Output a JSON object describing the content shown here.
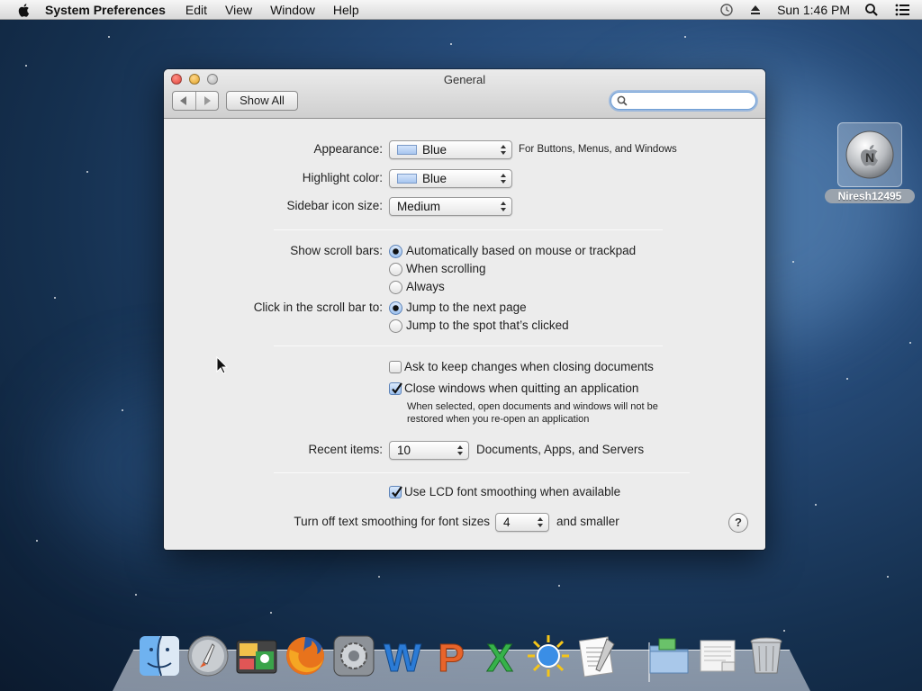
{
  "menubar": {
    "app_name": "System Preferences",
    "menus": [
      "Edit",
      "View",
      "Window",
      "Help"
    ],
    "clock": "Sun 1:46 PM"
  },
  "window": {
    "title": "General",
    "show_all_label": "Show All",
    "search_placeholder": ""
  },
  "general": {
    "appearance": {
      "label": "Appearance:",
      "value": "Blue",
      "hint": "For Buttons, Menus, and Windows"
    },
    "highlight": {
      "label": "Highlight color:",
      "value": "Blue"
    },
    "sidebar_icon_size": {
      "label": "Sidebar icon size:",
      "value": "Medium"
    },
    "scroll_bars": {
      "label": "Show scroll bars:",
      "options": [
        "Automatically based on mouse or trackpad",
        "When scrolling",
        "Always"
      ],
      "selected_index": 0
    },
    "click_scroll_bar": {
      "label": "Click in the scroll bar to:",
      "options": [
        "Jump to the next page",
        "Jump to the spot that’s clicked"
      ],
      "selected_index": 0
    },
    "ask_keep_changes": {
      "label": "Ask to keep changes when closing documents",
      "checked": false
    },
    "close_windows": {
      "label": "Close windows when quitting an application",
      "checked": true,
      "note_line1": "When selected, open documents and windows will not be",
      "note_line2": "restored when you re-open an application"
    },
    "recent_items": {
      "label": "Recent items:",
      "value": "10",
      "suffix": "Documents, Apps, and Servers"
    },
    "lcd_smoothing": {
      "label": "Use LCD font smoothing when available",
      "checked": true
    },
    "text_smoothing": {
      "label": "Turn off text smoothing for font sizes",
      "value": "4",
      "suffix": "and smaller"
    },
    "help_label": "?"
  },
  "desktop": {
    "user_name": "Niresh12495",
    "user_initial": "N"
  },
  "dock": {
    "items": [
      "finder-icon",
      "launchpad-icon",
      "photo-app-icon",
      "firefox-icon",
      "system-preferences-icon",
      "word-icon",
      "powerpoint-icon",
      "excel-icon",
      "weather-icon",
      "textedit-icon",
      "downloads-folder-icon",
      "document-stack-icon",
      "trash-icon"
    ],
    "word_letter": "W",
    "powerpoint_letter": "P",
    "excel_letter": "X"
  }
}
